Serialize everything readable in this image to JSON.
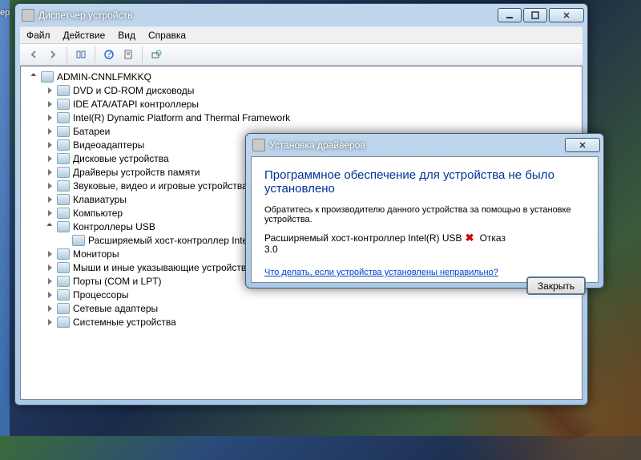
{
  "sidebar_fragment": "ер",
  "main": {
    "title": "Диспетчер устройств",
    "menu": {
      "file": "Файл",
      "action": "Действие",
      "view": "Вид",
      "help": "Справка"
    },
    "tree": {
      "root": "ADMIN-CNNLFMKKQ",
      "items": [
        {
          "label": "DVD и CD-ROM дисководы",
          "expanded": false
        },
        {
          "label": "IDE ATA/ATAPI контроллеры",
          "expanded": false
        },
        {
          "label": "Intel(R) Dynamic Platform and Thermal Framework",
          "expanded": false
        },
        {
          "label": "Батареи",
          "expanded": false
        },
        {
          "label": "Видеоадаптеры",
          "expanded": false
        },
        {
          "label": "Дисковые устройства",
          "expanded": false
        },
        {
          "label": "Драйверы устройств памяти",
          "expanded": false
        },
        {
          "label": "Звуковые, видео и игровые устройства",
          "expanded": false
        },
        {
          "label": "Клавиатуры",
          "expanded": false
        },
        {
          "label": "Компьютер",
          "expanded": false
        },
        {
          "label": "Контроллеры USB",
          "expanded": true,
          "children": [
            {
              "label": "Расширяемый хост-контроллер Intel(R) USB"
            }
          ]
        },
        {
          "label": "Мониторы",
          "expanded": false
        },
        {
          "label": "Мыши и иные указывающие устройства",
          "expanded": false
        },
        {
          "label": "Порты (COM и LPT)",
          "expanded": false
        },
        {
          "label": "Процессоры",
          "expanded": false
        },
        {
          "label": "Сетевые адаптеры",
          "expanded": false
        },
        {
          "label": "Системные устройства",
          "expanded": false
        }
      ]
    }
  },
  "dialog": {
    "title": "Установка драйверов",
    "heading": "Программное обеспечение для устройства не было установлено",
    "instruction": "Обратитесь к производителю данного устройства за помощью в установке устройства.",
    "device_line1": "Расширяемый хост-контроллер Intel(R) USB",
    "device_line2": "3.0",
    "status": "Отказ",
    "link": "Что делать, если устройства установлены неправильно?",
    "close_btn": "Закрыть"
  }
}
